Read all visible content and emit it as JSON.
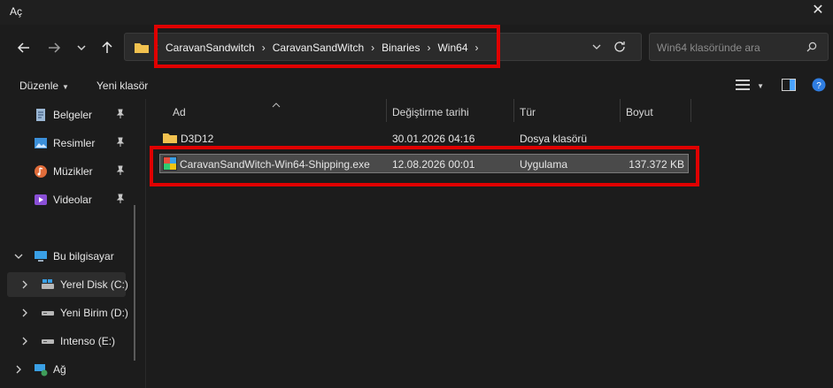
{
  "window": {
    "title": "Aç"
  },
  "address": {
    "crumbs": [
      "CaravanSandwitch",
      "CaravanSandWitch",
      "Binaries",
      "Win64"
    ]
  },
  "search": {
    "placeholder": "Win64 klasöründe ara"
  },
  "toolbar": {
    "organize_label": "Düzenle",
    "new_folder_label": "Yeni klasör"
  },
  "sidebar": {
    "quick": [
      {
        "label": "Belgeler"
      },
      {
        "label": "Resimler"
      },
      {
        "label": "Müzikler"
      },
      {
        "label": "Videolar"
      }
    ],
    "this_pc": {
      "label": "Bu bilgisayar"
    },
    "drives": [
      {
        "label": "Yerel Disk (C:)"
      },
      {
        "label": "Yeni Birim (D:)"
      },
      {
        "label": "Intenso (E:)"
      }
    ],
    "network": {
      "label": "Ağ"
    }
  },
  "columns": {
    "name": "Ad",
    "date": "Değiştirme tarihi",
    "type": "Tür",
    "size": "Boyut"
  },
  "files": [
    {
      "name": "D3D12",
      "date": "30.01.2026 04:16",
      "type": "Dosya klasörü",
      "size": ""
    },
    {
      "name": "CaravanSandWitch-Win64-Shipping.exe",
      "date": "12.08.2026 00:01",
      "type": "Uygulama",
      "size": "137.372 KB"
    }
  ],
  "colors": {
    "highlight": "#e00000",
    "background": "#1c1c1c",
    "folder": "#f2c24f"
  }
}
